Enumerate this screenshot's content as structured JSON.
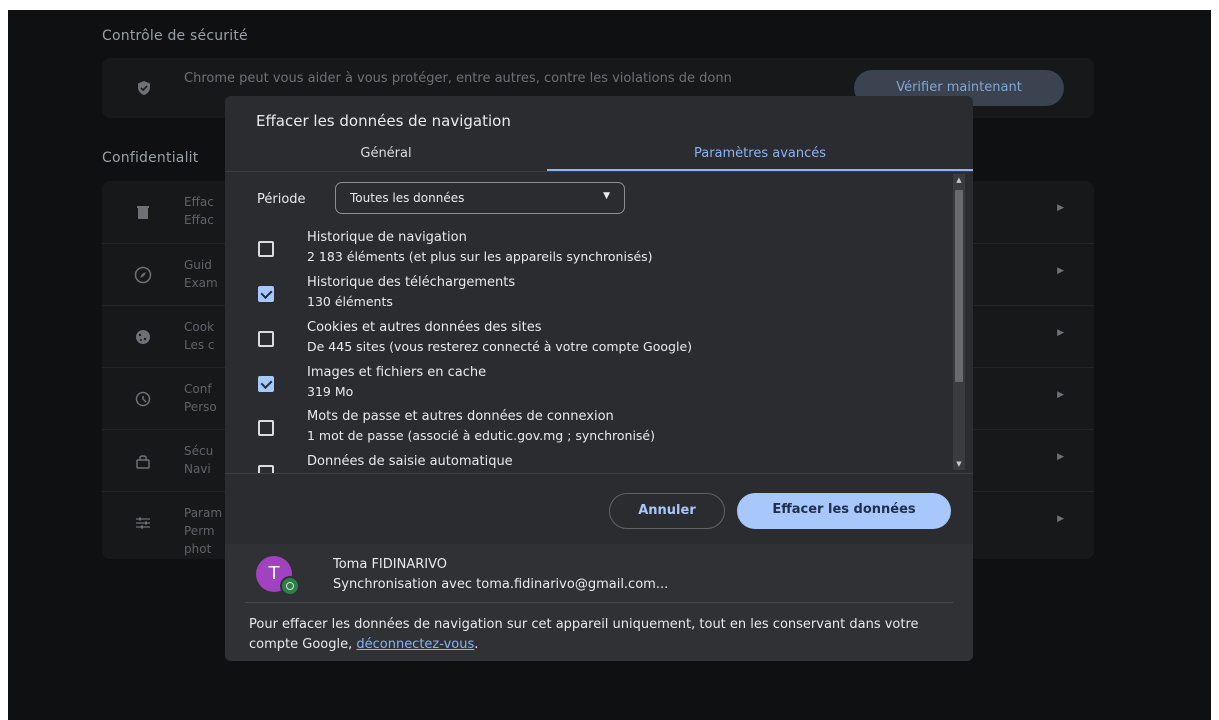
{
  "background": {
    "safety_section_title": "Contrôle de sécurité",
    "safety_card_text": "Chrome peut vous aider à vous protéger, entre autres, contre les violations de donn",
    "verify_button": "Vérifier maintenant",
    "privacy_section_title": "Confidentialit",
    "privacy_rows": [
      {
        "icon": "trash-icon",
        "line1": "Effac",
        "line2": "Effac"
      },
      {
        "icon": "compass-icon",
        "line1": "Guid",
        "line2": "Exam"
      },
      {
        "icon": "cookie-icon",
        "line1": "Cook",
        "line2": "Les c"
      },
      {
        "icon": "privacy-sandbox-icon",
        "line1": "Conf",
        "line2": "Perso"
      },
      {
        "icon": "lock-icon",
        "line1": "Sécu",
        "line2": "Navi"
      },
      {
        "icon": "tune-icon",
        "line1": "Param",
        "line2": "Perm",
        "line3": "phot"
      }
    ]
  },
  "dialog": {
    "title": "Effacer les données de navigation",
    "tabs": [
      {
        "label": "Général",
        "active": false
      },
      {
        "label": "Paramètres avancés",
        "active": true
      }
    ],
    "period_label": "Période",
    "period_value": "Toutes les données",
    "options": [
      {
        "title": "Historique de navigation",
        "subtitle": "2 183 éléments (et plus sur les appareils synchronisés)",
        "checked": false
      },
      {
        "title": "Historique des téléchargements",
        "subtitle": "130 éléments",
        "checked": true
      },
      {
        "title": "Cookies et autres données des sites",
        "subtitle": "De 445 sites (vous resterez connecté à votre compte Google)",
        "checked": false
      },
      {
        "title": "Images et fichiers en cache",
        "subtitle": "319 Mo",
        "checked": true
      },
      {
        "title": "Mots de passe et autres données de connexion",
        "subtitle": "1 mot de passe (associé à edutic.gov.mg ; synchronisé)",
        "checked": false
      },
      {
        "title": "Données de saisie automatique",
        "subtitle": "",
        "checked": false
      }
    ],
    "cancel_button": "Annuler",
    "clear_button": "Effacer les données",
    "account": {
      "avatar_letter": "T",
      "name": "Toma FIDINARIVO",
      "sync_text": "Synchronisation avec toma.fidinarivo@gmail.com..."
    },
    "info_text_before": "Pour effacer les données de navigation sur cet appareil uniquement, tout en les conservant dans votre compte Google, ",
    "info_link": "déconnectez-vous",
    "info_text_after": "."
  },
  "colors": {
    "accent": "#8ab4f8",
    "button_fill": "#a8c7fa",
    "dialog_bg": "#2b2c30",
    "avatar": "#a142c1"
  }
}
